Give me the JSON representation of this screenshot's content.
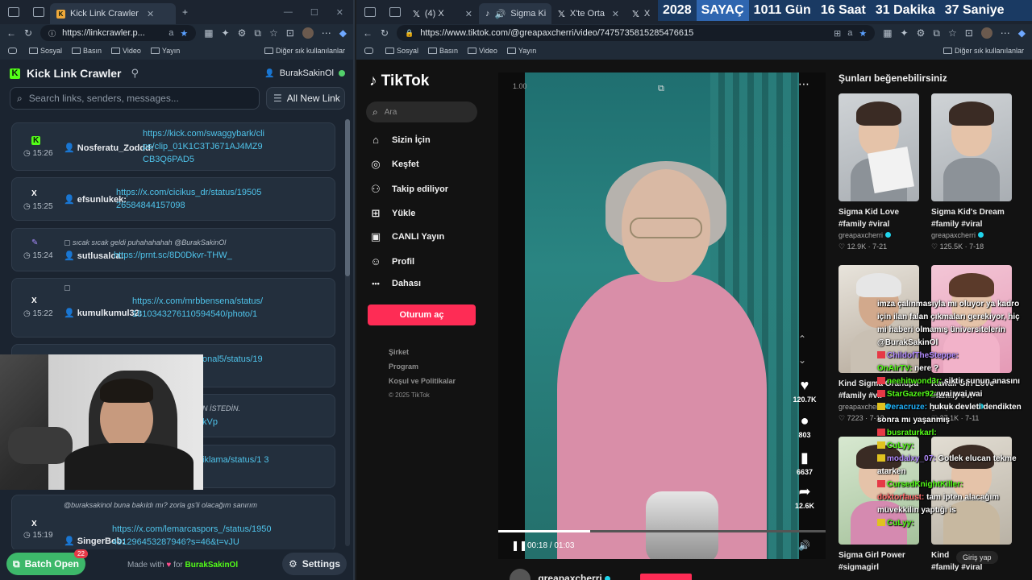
{
  "left_browser": {
    "tab_title": "Kick Link Crawler",
    "url": "https://linkcrawler.p...",
    "bookmarks": [
      "Sosyal",
      "Basın",
      "Video",
      "Yayın"
    ],
    "bookmarks_other": "Diğer sık kullanılanlar"
  },
  "kick": {
    "title": "Kick Link Crawler",
    "username": "BurakSakinOl",
    "search_placeholder": "Search links, senders, messages...",
    "filter_label": "All New Link",
    "cards": [
      {
        "source": "K",
        "time": "15:26",
        "sender": "Nosferatu_Zoddd:",
        "message": "",
        "link": "https://kick.com/swaggybark/clips/clip_01K1C3TJ671AJ4MZ9CB3Q6PAD5"
      },
      {
        "source": "X",
        "time": "15:25",
        "sender": "efsunlukek:",
        "message": "",
        "link": "https://x.com/cicikus_dr/status/1950526584844157098"
      },
      {
        "source": "✎",
        "time": "15:24",
        "sender": "sutlusalca:",
        "message": "sıcak sıcak geldi puhahahahah @BurakSakinOl",
        "link": "https://prnt.sc/8D0Dkvr-THW_"
      },
      {
        "source": "X",
        "time": "15:22",
        "sender": "kumulkumul32:",
        "message": "",
        "link": "https://x.com/mrbbensena/status/1810343276110594540/photo/1"
      },
      {
        "source": "",
        "time": "",
        "sender": "",
        "message": "",
        "link": "onal5/status/19"
      },
      {
        "source": "",
        "time": "",
        "sender": "",
        "message": "N İSTEDİN.",
        "link": "kVp"
      },
      {
        "source": "",
        "time": "",
        "sender": "",
        "message": "",
        "link": "iklama/status/1 3"
      },
      {
        "source": "X",
        "time": "15:19",
        "sender": "SingerBob:",
        "message": "@buraksakinol buna bakıldı mı? zorla gs'li olacağım sanırım",
        "link": "https://x.com/lemarcaspors_/status/1950491296453287946?s=46&t=vJU"
      }
    ],
    "batch_label": "Batch Open",
    "batch_count": "22",
    "made_with": "Made with",
    "made_for": "for",
    "made_by": "BurakSakinOl",
    "settings_label": "Settings"
  },
  "right_browser": {
    "tabs": [
      "(4) X",
      "Sigma Ki",
      "X'te Orta Saha",
      "X"
    ],
    "url": "https://www.tiktok.com/@greapaxcherri/video/7475735815285476615",
    "bookmarks": [
      "Sosyal",
      "Basın",
      "Video",
      "Yayın"
    ],
    "bookmarks_other": "Diğer sık kullanılanlar"
  },
  "counter": {
    "year": "2028",
    "label": "SAYAÇ",
    "days": "1011 Gün",
    "hours": "16 Saat",
    "minutes": "31 Dakika",
    "seconds": "37 Saniye"
  },
  "tiktok": {
    "logo": "TikTok",
    "search_placeholder": "Ara",
    "nav": [
      {
        "icon": "⌂",
        "label": "Sizin İçin"
      },
      {
        "icon": "◎",
        "label": "Keşfet"
      },
      {
        "icon": "⚇",
        "label": "Takip ediliyor"
      },
      {
        "icon": "⊞",
        "label": "Yükle"
      },
      {
        "icon": "▣",
        "label": "CANLI Yayın"
      },
      {
        "icon": "☺",
        "label": "Profil"
      },
      {
        "icon": "•••",
        "label": "Dahası"
      }
    ],
    "login_label": "Oturum aç",
    "footer": [
      "Şirket",
      "Program",
      "Koşul ve Politikalar",
      "© 2025 TikTok"
    ],
    "video": {
      "speed": "1.00",
      "time": "00:18 / 01:03",
      "progress": 0.28,
      "likes": "120.7K",
      "comments": "803",
      "saves": "6637",
      "shares": "12.6K",
      "author": "greapaxcherri"
    },
    "recs_title": "Şunları beğenebilirsiniz",
    "recs": [
      {
        "title": "Sigma Kid Love",
        "tag": "#family #viral",
        "author": "greapaxcherri",
        "likes": "♡ 12.9K",
        "date": "7-21"
      },
      {
        "title": "Sigma Kid's Dream",
        "tag": "#family #viral",
        "author": "greapaxcherri",
        "likes": "♡ 125.5K",
        "date": "7-18"
      },
      {
        "title": "Kind Sigma Grandpa",
        "tag": "#family #vir",
        "author": "greapaxcherri",
        "likes": "♡ 7223",
        "date": "7-13"
      },
      {
        "title": "Kawaii Girl Love",
        "tag": "#family #vi",
        "author": "greapaxcherri",
        "likes": "♡ 37.1K",
        "date": "7-11"
      },
      {
        "title": "Sigma Girl Power",
        "tag": "#sigmagirl",
        "author": "",
        "likes": "",
        "date": ""
      },
      {
        "title": "Kind",
        "tag": "#family #viral",
        "author": "",
        "likes": "",
        "date": ""
      }
    ],
    "girl_button": "Giriş yap"
  },
  "chat": [
    {
      "user": "",
      "text": "imza çalınmasıyla mı oluyor ya kadro için ilan falan çıkmaları gerekiyor, hiç mi haberi olmamış üniversitelerin @BurakSakinOl",
      "color": "#ffffff",
      "badge": ""
    },
    {
      "user": "ChildofTheSteppe:",
      "text": "",
      "color": "#b38cff",
      "badge": "#e63946"
    },
    {
      "user": "OnAirTV:",
      "text": "nere ?",
      "color": "#53fc18",
      "badge": ""
    },
    {
      "user": "neehitwond3r:",
      "text": "siktir sunun anasını",
      "color": "#53fc18",
      "badge": "#e63946"
    },
    {
      "user": "StarGazer92:",
      "text": "wai wai wai",
      "color": "#53fc18",
      "badge": "#e63946"
    },
    {
      "user": "veracruze:",
      "text": "hukuk devleti dendikten sonra mı yaşanmış",
      "color": "#1fb3ff",
      "badge": "#e0c21f"
    },
    {
      "user": "busraturkarl:",
      "text": "",
      "color": "#53fc18",
      "badge": "#e63946"
    },
    {
      "user": "CuLyy:",
      "text": "",
      "color": "#53fc18",
      "badge": "#e0c21f"
    },
    {
      "user": "modalxy_07:",
      "text": "Gotlek elucan tekme atarken",
      "color": "#b38cff",
      "badge": "#e0c21f"
    },
    {
      "user": "CursedKnightKiller:",
      "text": "",
      "color": "#53fc18",
      "badge": "#e63946"
    },
    {
      "user": "doktorfaust:",
      "text": "tam ipten alacağım müvekkilin yaptığı is",
      "color": "#ff6b6b",
      "badge": ""
    },
    {
      "user": "CuLyy:",
      "text": "",
      "color": "#53fc18",
      "badge": "#e0c21f"
    }
  ]
}
